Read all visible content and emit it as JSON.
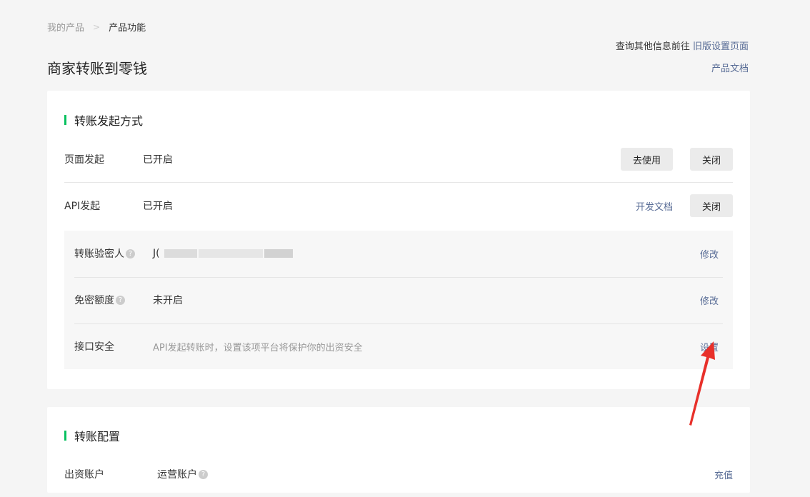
{
  "breadcrumb": {
    "parent": "我的产品",
    "current": "产品功能"
  },
  "top_note": {
    "prefix": "查询其他信息前往",
    "link": "旧版设置页面"
  },
  "page_title": "商家转账到零钱",
  "doc_link": "产品文档",
  "section1": {
    "title": "转账发起方式",
    "rows": [
      {
        "label": "页面发起",
        "value": "已开启",
        "use_btn": "去使用",
        "close_btn": "关闭"
      },
      {
        "label": "API发起",
        "value": "已开启",
        "doc_link": "开发文档",
        "close_btn": "关闭"
      }
    ],
    "sub_rows": [
      {
        "label": "转账验密人",
        "value": "J(",
        "action": "修改"
      },
      {
        "label": "免密额度",
        "value": "未开启",
        "action": "修改"
      },
      {
        "label": "接口安全",
        "value": "API发起转账时，设置该项平台将保护你的出资安全",
        "action": "设置"
      }
    ]
  },
  "section2": {
    "title": "转账配置",
    "row": {
      "label": "出资账户",
      "value": "运营账户",
      "action": "充值"
    }
  },
  "colors": {
    "accent": "#07c160",
    "link": "#576b95",
    "arrow": "#e8302a"
  }
}
